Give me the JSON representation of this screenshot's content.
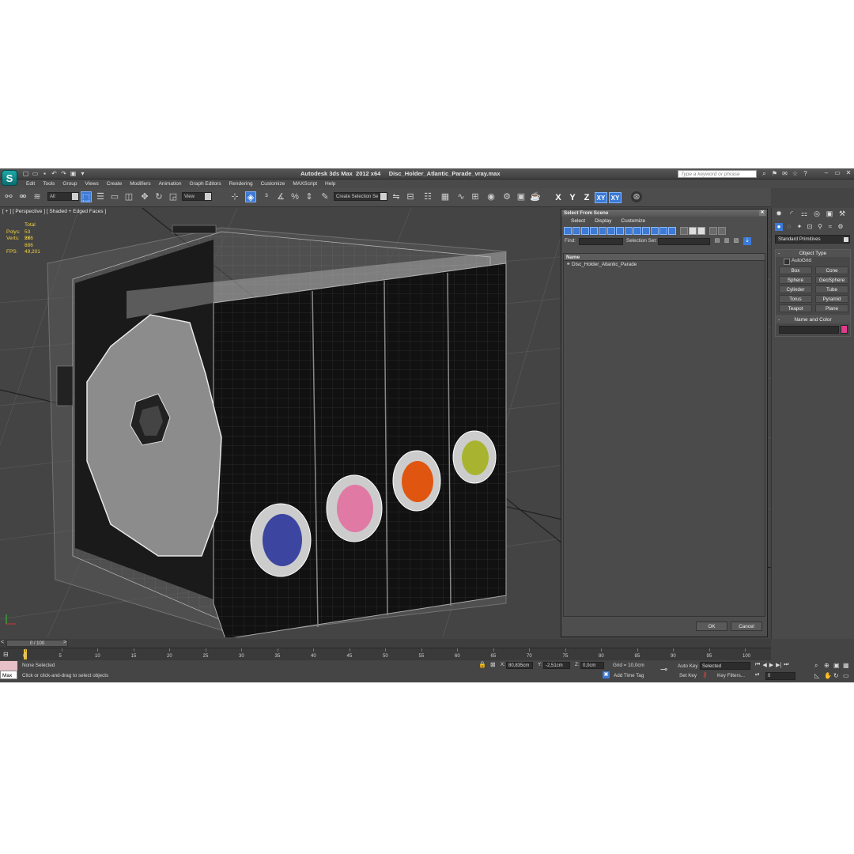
{
  "app": {
    "logo": "S",
    "title": "Autodesk 3ds Max  2012 x64     Disc_Holder_Atlantic_Parade_vray.max",
    "search_placeholder": "Type a keyword or phrase"
  },
  "menu": [
    "Edit",
    "Tools",
    "Group",
    "Views",
    "Create",
    "Modifiers",
    "Animation",
    "Graph Editors",
    "Rendering",
    "Customize",
    "MAXScript",
    "Help"
  ],
  "toolbar": {
    "filter_value": "All",
    "refcoord_value": "View",
    "selection_set_placeholder": "Create Selection Se",
    "axes": [
      "X",
      "Y",
      "Z",
      "XY",
      "XY"
    ]
  },
  "viewport": {
    "label": "[ + ] [ Perspective ] [ Shaded + Edged Faces ]",
    "stats": {
      "total_label": "Total",
      "polys_label": "Polys:",
      "polys_value": "53 576",
      "verts_label": "Verts:",
      "verts_value": "26 886",
      "fps_label": "FPS:",
      "fps_value": "49,201"
    },
    "model_colors": {
      "blue": "#3c46a0",
      "pink": "#e07aa4",
      "orange": "#e05510",
      "green": "#a8b430"
    }
  },
  "dialog": {
    "title": "Select From Scene",
    "menu": [
      "Select",
      "Display",
      "Customize"
    ],
    "find_label": "Find:",
    "selection_set_label": "Selection Set:",
    "list_header": "Name",
    "items": [
      "Disc_Holder_Atlantic_Parade"
    ],
    "ok": "OK",
    "cancel": "Cancel"
  },
  "command_panel": {
    "category": "Standard Primitives",
    "object_type_header": "Object Type",
    "autogrid": "AutoGrid",
    "primitives": [
      "Box",
      "Cone",
      "Sphere",
      "GeoSphere",
      "Cylinder",
      "Tube",
      "Torus",
      "Pyramid",
      "Teapot",
      "Plane"
    ],
    "name_color_header": "Name and Color",
    "swatch_color": "#e23b8e"
  },
  "timeline": {
    "slider": "0 / 100",
    "ticks": [
      "0",
      "5",
      "10",
      "15",
      "20",
      "25",
      "30",
      "35",
      "40",
      "45",
      "50",
      "55",
      "60",
      "65",
      "70",
      "75",
      "80",
      "85",
      "90",
      "95",
      "100"
    ]
  },
  "status": {
    "maxscript": "Max",
    "selection": "None Selected",
    "prompt": "Click or click-and-drag to select objects",
    "x_label": "X:",
    "x_value": "80,835cm",
    "y_label": "Y:",
    "y_value": "-2,51cm",
    "z_label": "Z:",
    "z_value": "0,0cm",
    "grid": "Grid = 10,0cm",
    "add_time_tag": "Add Time Tag",
    "auto_key": "Auto Key",
    "auto_key_mode": "Selected",
    "set_key": "Set Key",
    "key_filters": "Key Filters...",
    "frame": "0"
  }
}
